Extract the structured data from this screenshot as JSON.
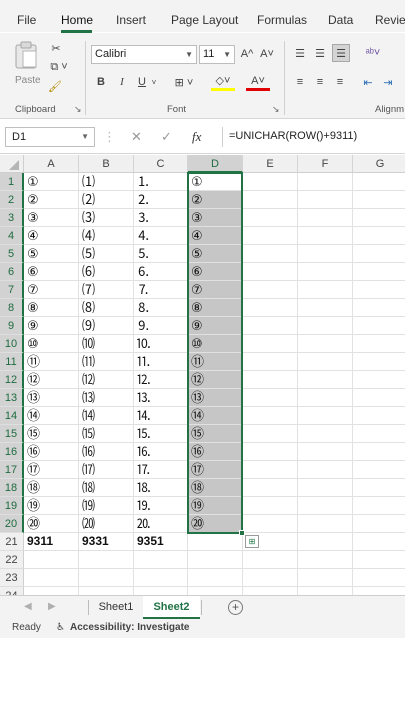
{
  "ribbon": {
    "tabs": [
      "File",
      "Home",
      "Insert",
      "Page Layout",
      "Formulas",
      "Data",
      "Review"
    ],
    "active_tab": "Home",
    "clipboard": {
      "paste_label": "Paste",
      "group_label": "Clipboard"
    },
    "font": {
      "name": "Calibri",
      "size": "11",
      "group_label": "Font",
      "bold": "B",
      "italic": "I",
      "underline": "U",
      "grow": "A^",
      "shrink": "A˅",
      "font_color_letter": "A"
    },
    "alignment": {
      "group_label": "Alignm"
    }
  },
  "formula_bar": {
    "name_box": "D1",
    "formula": "=UNICHAR(ROW()+9311)",
    "fx": "fx"
  },
  "grid": {
    "columns": [
      "A",
      "B",
      "C",
      "D",
      "E",
      "F",
      "G"
    ],
    "row_numbers": [
      "1",
      "2",
      "3",
      "4",
      "5",
      "6",
      "7",
      "8",
      "9",
      "10",
      "11",
      "12",
      "13",
      "14",
      "15",
      "16",
      "17",
      "18",
      "19",
      "20",
      "21",
      "22",
      "23",
      "24"
    ],
    "col_a": [
      "①",
      "②",
      "③",
      "④",
      "⑤",
      "⑥",
      "⑦",
      "⑧",
      "⑨",
      "⑩",
      "⑪",
      "⑫",
      "⑬",
      "⑭",
      "⑮",
      "⑯",
      "⑰",
      "⑱",
      "⑲",
      "⑳"
    ],
    "col_b": [
      "⑴",
      "⑵",
      "⑶",
      "⑷",
      "⑸",
      "⑹",
      "⑺",
      "⑻",
      "⑼",
      "⑽",
      "⑾",
      "⑿",
      "⒀",
      "⒁",
      "⒂",
      "⒃",
      "⒄",
      "⒅",
      "⒆",
      "⒇"
    ],
    "col_c": [
      "⒈",
      "⒉",
      "⒊",
      "⒋",
      "⒌",
      "⒍",
      "⒎",
      "⒏",
      "⒐",
      "⒑",
      "⒒",
      "⒓",
      "⒔",
      "⒕",
      "⒖",
      "⒗",
      "⒘",
      "⒙",
      "⒚",
      "⒛"
    ],
    "col_d": [
      "①",
      "②",
      "③",
      "④",
      "⑤",
      "⑥",
      "⑦",
      "⑧",
      "⑨",
      "⑩",
      "⑪",
      "⑫",
      "⑬",
      "⑭",
      "⑮",
      "⑯",
      "⑰",
      "⑱",
      "⑲",
      "⑳"
    ],
    "row21": [
      "9311",
      "9331",
      "9351"
    ],
    "selected_column": "D",
    "selected_rows": "1-20"
  },
  "sheets": {
    "tabs": [
      "Sheet1",
      "Sheet2"
    ],
    "active": "Sheet2",
    "add_symbol": "+"
  },
  "status": {
    "mode": "Ready",
    "accessibility": "Accessibility: Investigate"
  },
  "colors": {
    "accent": "#217346",
    "selection_fill": "#c6c6c6"
  }
}
